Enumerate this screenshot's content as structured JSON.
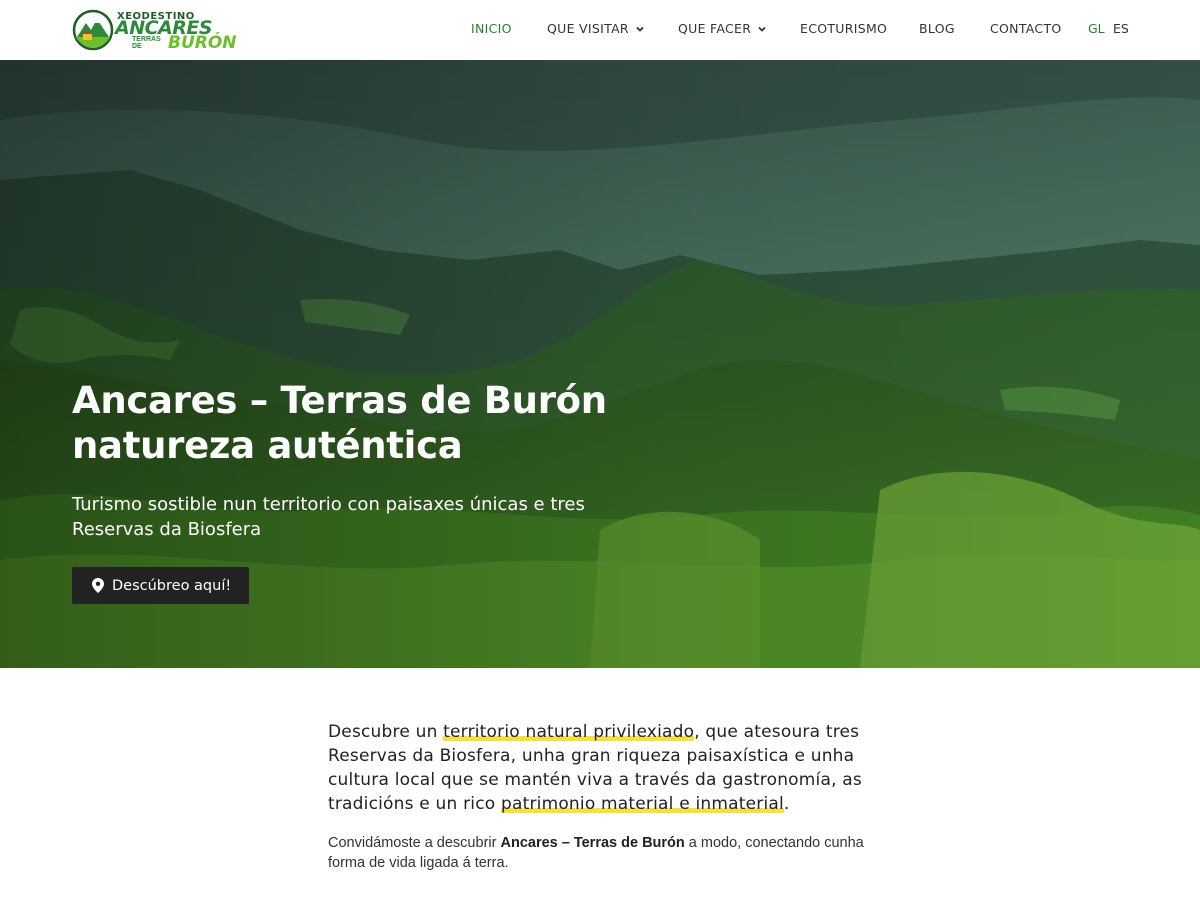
{
  "header": {
    "logo": {
      "kicker": "XEODESTINO",
      "main": "ANCARES",
      "sub1": "TERRAS",
      "sub2": "DE",
      "sub3": "BURÓN"
    },
    "nav": [
      {
        "label": "INICIO",
        "active": true,
        "has_dropdown": false
      },
      {
        "label": "QUE VISITAR",
        "active": false,
        "has_dropdown": true
      },
      {
        "label": "QUE FACER",
        "active": false,
        "has_dropdown": true
      },
      {
        "label": "ECOTURISMO",
        "active": false,
        "has_dropdown": false
      },
      {
        "label": "BLOG",
        "active": false,
        "has_dropdown": false
      },
      {
        "label": "CONTACTO",
        "active": false,
        "has_dropdown": false
      }
    ],
    "languages": [
      {
        "code": "GL",
        "active": true
      },
      {
        "code": "ES",
        "active": false
      }
    ]
  },
  "hero": {
    "title_line1": "Ancares – Terras de Burón",
    "title_line2": "natureza auténtica",
    "subtitle": "Turismo sostible nun territorio con paisaxes únicas e tres Reservas da Biosfera",
    "cta_icon": "map-pin-icon",
    "cta_label": "Descúbreo aquí!"
  },
  "intro": {
    "part1": "Descubre un ",
    "highlight1": "territorio natural privilexiado",
    "part2": ", que atesoura tres Reservas da Biosfera, unha gran riqueza paisaxística e unha cultura local que se mantén viva a través da gastronomía, as tradicións e un rico ",
    "highlight2": "patrimonio material e inmaterial",
    "part3": "."
  },
  "body": {
    "part1": "Convidámoste a descubrir ",
    "bold": "Ancares – Terras de Burón",
    "part2": " a modo, conectando cunha forma de vida ligada á terra."
  },
  "colors": {
    "accent_green": "#2d7a36",
    "logo_green": "#2d8a3a",
    "logo_lime": "#6cbf2a",
    "highlight_yellow": "#f3e23a",
    "button_bg": "#222222"
  }
}
